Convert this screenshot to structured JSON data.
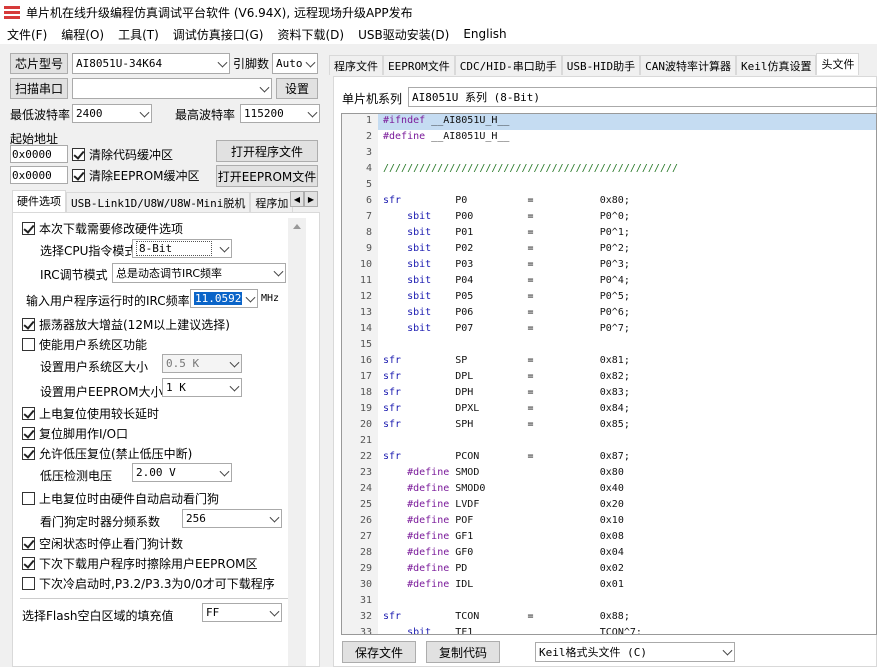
{
  "window": {
    "title": "单片机在线升级编程仿真调试平台软件 (V6.94X), 远程现场升级APP发布"
  },
  "menu": [
    "文件(F)",
    "编程(O)",
    "工具(T)",
    "调试仿真接口(G)",
    "资料下载(D)",
    "USB驱动安装(D)",
    "English"
  ],
  "left": {
    "chip_button": "芯片型号",
    "chip_value": "AI8051U-34K64",
    "pin_label": "引脚数",
    "pin_value": "Auto",
    "scan_button": "扫描串口",
    "port_value": "",
    "settings_button": "设置",
    "min_baud_label": "最低波特率",
    "min_baud_value": "2400",
    "max_baud_label": "最高波特率",
    "max_baud_value": "115200",
    "start_addr_label": "起始地址",
    "addr1": "0x0000",
    "clear_code_label": "清除代码缓冲区",
    "open_prog_button": "打开程序文件",
    "addr2": "0x0000",
    "clear_eeprom_label": "清除EEPROM缓冲区",
    "open_eeprom_button": "打开EEPROM文件",
    "tabs": [
      "硬件选项",
      "USB-Link1D/U8W/U8W-Mini脱机",
      "程序加"
    ]
  },
  "hw": {
    "modify_label": "本次下载需要修改硬件选项",
    "cpu_mode_label": "选择CPU指令模式",
    "cpu_mode_value": "8-Bit",
    "irc_mode_label": "IRC调节模式",
    "irc_mode_value": "总是动态调节IRC频率",
    "irc_freq_label": "输入用户程序运行时的IRC频率",
    "irc_freq_value": "11.0592",
    "irc_unit": "MHz",
    "osc_label": "振荡器放大增益(12M以上建议选择)",
    "user_sys_label": "使能用户系统区功能",
    "sys_size_label": "设置用户系统区大小",
    "sys_size_value": "0.5 K",
    "eeprom_size_label": "设置用户EEPROM大小",
    "eeprom_size_value": "1   K",
    "long_delay_label": "上电复位使用较长延时",
    "reset_io_label": "复位脚用作I/O口",
    "lvr_label": "允许低压复位(禁止低压中断)",
    "lvd_label": "低压检测电压",
    "lvd_value": "2.00 V",
    "wdt_auto_label": "上电复位时由硬件自动启动看门狗",
    "wdt_div_label": "看门狗定时器分频系数",
    "wdt_div_value": "256",
    "idle_wdt_label": "空闲状态时停止看门狗计数",
    "erase_eeprom_label": "下次下载用户程序时擦除用户EEPROM区",
    "cold_boot_label": "下次冷启动时,P3.2/P3.3为0/0才可下载程序",
    "fill_label": "选择Flash空白区域的填充值",
    "fill_value": "FF"
  },
  "right": {
    "tabs": [
      "程序文件",
      "EEPROM文件",
      "CDC/HID-串口助手",
      "USB-HID助手",
      "CAN波特率计算器",
      "Keil仿真设置",
      "头文件"
    ],
    "series_label": "单片机系列",
    "series_value": "AI8051U 系列 (8-Bit)",
    "save_button": "保存文件",
    "copy_button": "复制代码",
    "format_value": "Keil格式头文件 (C)"
  },
  "code_lines": [
    "#ifndef __AI8051U_H__",
    "#define __AI8051U_H__",
    "",
    "/////////////////////////////////////////////////",
    "",
    "sfr         P0          =           0x80;",
    "    sbit    P00         =           P0^0;",
    "    sbit    P01         =           P0^1;",
    "    sbit    P02         =           P0^2;",
    "    sbit    P03         =           P0^3;",
    "    sbit    P04         =           P0^4;",
    "    sbit    P05         =           P0^5;",
    "    sbit    P06         =           P0^6;",
    "    sbit    P07         =           P0^7;",
    "",
    "sfr         SP          =           0x81;",
    "sfr         DPL         =           0x82;",
    "sfr         DPH         =           0x83;",
    "sfr         DPXL        =           0x84;",
    "sfr         SPH         =           0x85;",
    "",
    "sfr         PCON        =           0x87;",
    "    #define SMOD                    0x80",
    "    #define SMOD0                   0x40",
    "    #define LVDF                    0x20",
    "    #define POF                     0x10",
    "    #define GF1                     0x08",
    "    #define GF0                     0x04",
    "    #define PD                      0x02",
    "    #define IDL                     0x01",
    "",
    "sfr         TCON        =           0x88;",
    "    sbit    TF1                     TCON^7;"
  ]
}
